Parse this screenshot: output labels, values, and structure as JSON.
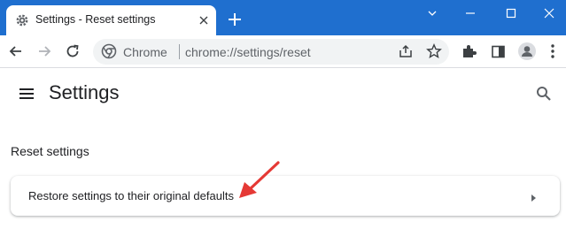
{
  "tab": {
    "title": "Settings - Reset settings"
  },
  "omnibox": {
    "site_label": "Chrome",
    "url": "chrome://settings/reset"
  },
  "settings": {
    "title": "Settings",
    "section_title": "Reset settings",
    "restore_row_label": "Restore settings to their original defaults"
  },
  "colors": {
    "titlebar": "#1f6fcf",
    "annotation_arrow": "#e53935"
  },
  "icons": [
    "gear-icon",
    "close-icon",
    "new-tab-icon",
    "chevron-down-icon",
    "minimize-icon",
    "maximize-icon",
    "window-close-icon",
    "back-icon",
    "forward-icon",
    "reload-icon",
    "chrome-logo-icon",
    "share-icon",
    "star-icon",
    "extensions-icon",
    "side-panel-icon",
    "profile-icon",
    "kebab-menu-icon",
    "hamburger-menu-icon",
    "search-icon",
    "arrow-right-icon"
  ]
}
